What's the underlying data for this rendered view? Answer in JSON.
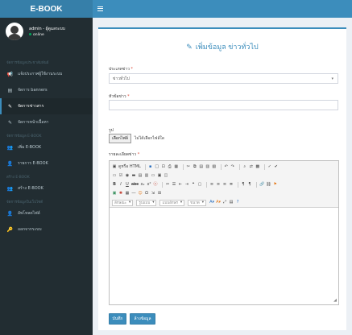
{
  "app": {
    "logo": "E-BOOK"
  },
  "user": {
    "name": "admin - ผู้ดูแลระบบ",
    "status": "online"
  },
  "sidebar": {
    "headers": [
      "จัดการข้อมูลประชาสัมพันธ์",
      "จัดการข้อมูล E-BOOK",
      "สร้าง E-BOOK",
      "จัดการข้อมูลในเว็บไซต์"
    ],
    "items": [
      {
        "label": "แจ้งประกาศผู้ใช้งานระบบ",
        "icon": "bullhorn-icon",
        "glyph": "📢"
      },
      {
        "label": "จัดการ banners",
        "icon": "image-icon",
        "glyph": "▤"
      },
      {
        "label": "จัดการข่าวสาร",
        "icon": "edit-icon",
        "glyph": "✎"
      },
      {
        "label": "จัดการหน้าเนื้อหา",
        "icon": "edit-icon",
        "glyph": "✎"
      },
      {
        "label": "เพิ่ม E-BOOK",
        "icon": "users-icon",
        "glyph": "👥"
      },
      {
        "label": "รายการ E-BOOK",
        "icon": "user-icon",
        "glyph": "👤"
      },
      {
        "label": "สร้าง E-BOOK",
        "icon": "users-icon",
        "glyph": "👥"
      },
      {
        "label": "อัพโหลดไฟล์",
        "icon": "user-icon",
        "glyph": "👤"
      },
      {
        "label": "ออกจากระบบ",
        "icon": "key-icon",
        "glyph": "🔑"
      }
    ]
  },
  "form": {
    "title": "เพิ่มข้อมูล ข่าวทั่วไป",
    "title_icon": "✎",
    "category_label": "ประเภทข่าว",
    "category_value": "ข่าวทั่วไป",
    "headline_label": "หัวข้อข่าว",
    "image_label": "รูป",
    "file_button": "เลือกไฟล์",
    "file_text": "ไม่ได้เลือกไฟล์ใด",
    "detail_label": "รายละเอียดข่าว",
    "required_mark": "*"
  },
  "editor": {
    "source_label": "ดูหรือ HTML",
    "combo_style": "ลักษณะ",
    "combo_format": "รูปแบบ",
    "combo_font": "แบบอักษร",
    "combo_size": "ขนาด"
  },
  "buttons": {
    "save": "บันทึก",
    "reset": "ล้างข้อมูล"
  }
}
